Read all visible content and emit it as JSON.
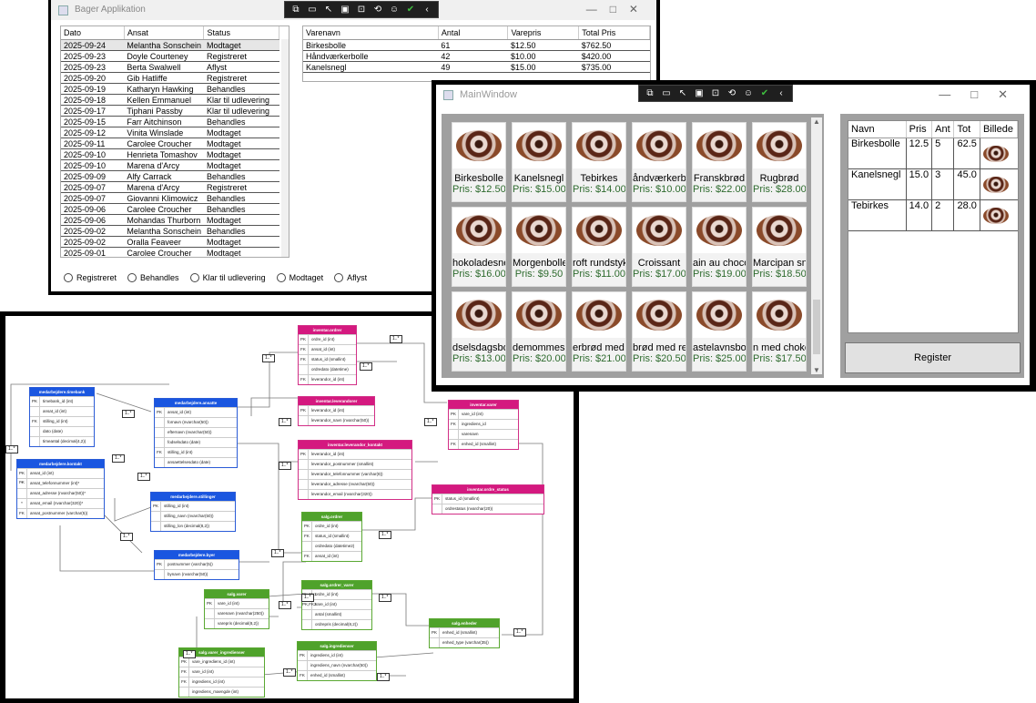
{
  "bager": {
    "title": "Bager Applikation",
    "orders_headers": [
      "Dato",
      "Ansat",
      "Status"
    ],
    "orders": [
      [
        "2025-09-24",
        "Melantha Sonschein",
        "Modtaget"
      ],
      [
        "2025-09-23",
        "Doyle Courteney",
        "Registreret"
      ],
      [
        "2025-09-23",
        "Berta Swalwell",
        "Aflyst"
      ],
      [
        "2025-09-20",
        "Gib Hatliffe",
        "Registreret"
      ],
      [
        "2025-09-19",
        "Katharyn Hawking",
        "Behandles"
      ],
      [
        "2025-09-18",
        "Kellen Emmanuel",
        "Klar til udlevering"
      ],
      [
        "2025-09-17",
        "Tiphani Passby",
        "Klar til udlevering"
      ],
      [
        "2025-09-15",
        "Farr Aitchinson",
        "Behandles"
      ],
      [
        "2025-09-12",
        "Vinita Winslade",
        "Modtaget"
      ],
      [
        "2025-09-11",
        "Carolee Croucher",
        "Modtaget"
      ],
      [
        "2025-09-10",
        "Henrieta Tomashov",
        "Modtaget"
      ],
      [
        "2025-09-10",
        "Marena d'Arcy",
        "Modtaget"
      ],
      [
        "2025-09-09",
        "Alfy Carrack",
        "Behandles"
      ],
      [
        "2025-09-07",
        "Marena d'Arcy",
        "Registreret"
      ],
      [
        "2025-09-07",
        "Giovanni Klimowicz",
        "Behandles"
      ],
      [
        "2025-09-06",
        "Carolee Croucher",
        "Behandles"
      ],
      [
        "2025-09-06",
        "Mohandas Thurborn",
        "Modtaget"
      ],
      [
        "2025-09-02",
        "Melantha Sonschein",
        "Behandles"
      ],
      [
        "2025-09-02",
        "Oralla Feaveer",
        "Modtaget"
      ],
      [
        "2025-09-01",
        "Carolee Croucher",
        "Modtaget"
      ]
    ],
    "items_headers": [
      "Varenavn",
      "Antal",
      "Varepris",
      "Total Pris"
    ],
    "items": [
      [
        "Birkesbolle",
        "61",
        "$12.50",
        "$762.50"
      ],
      [
        "Håndværkerbolle",
        "42",
        "$10.00",
        "$420.00"
      ],
      [
        "Kanelsnegl",
        "49",
        "$15.00",
        "$735.00"
      ]
    ],
    "filters": [
      "Registreret",
      "Behandles",
      "Klar til udlevering",
      "Modtaget",
      "Aflyst"
    ]
  },
  "main": {
    "title": "MainWindow",
    "products": [
      {
        "name": "Birkesbolle",
        "price": "Pris: $12.50"
      },
      {
        "name": "Kanelsnegl",
        "price": "Pris: $15.00"
      },
      {
        "name": "Tebirkes",
        "price": "Pris: $14.00"
      },
      {
        "name": "åndværkerbo",
        "price": "Pris: $10.00"
      },
      {
        "name": "Franskbrød",
        "price": "Pris: $22.00"
      },
      {
        "name": "Rugbrød",
        "price": "Pris: $28.00"
      },
      {
        "name": "hokoladesne",
        "price": "Pris: $16.00"
      },
      {
        "name": "Morgenbolle",
        "price": "Pris: $9.50"
      },
      {
        "name": "roft rundstyk",
        "price": "Pris: $11.00"
      },
      {
        "name": "Croissant",
        "price": "Pris: $17.00"
      },
      {
        "name": "ain au chocol",
        "price": "Pris: $19.00"
      },
      {
        "name": "Marcipan sneg",
        "price": "Pris: $18.50"
      },
      {
        "name": "dselsdagsbo",
        "price": "Pris: $13.00"
      },
      {
        "name": "demommesn",
        "price": "Pris: $20.00"
      },
      {
        "name": "erbrød med c",
        "price": "Pris: $21.00"
      },
      {
        "name": "brød med re",
        "price": "Pris: $20.50"
      },
      {
        "name": "astelavnsboll",
        "price": "Pris: $25.00"
      },
      {
        "name": "n med choko",
        "price": "Pris: $17.50"
      }
    ],
    "cart_headers": [
      "Navn",
      "Pris",
      "Ant",
      "Tot",
      "Billede"
    ],
    "cart": [
      [
        "Birkesbolle",
        "12.5",
        "5",
        "62.5"
      ],
      [
        "Kanelsnegl",
        "15.0",
        "3",
        "45.0"
      ],
      [
        "Tebirkes",
        "14.0",
        "2",
        "28.0"
      ]
    ],
    "register_label": "Register"
  },
  "erd": {
    "entities": [
      {
        "title": "medarbejdere.timebank",
        "color": "blue",
        "rows": [
          [
            "PK",
            "timebank_id (int)"
          ],
          [
            "",
            "ansat_id (int)"
          ],
          [
            "FK",
            "stilling_id (int)"
          ],
          [
            "",
            "dato (date)"
          ],
          [
            "",
            "timeantal (decimal(4,2))"
          ]
        ]
      },
      {
        "title": "medarbejdere.ansatte",
        "color": "blue",
        "rows": [
          [
            "PK",
            "ansat_id (int)"
          ],
          [
            "",
            "fornavn (nvarchar(50))"
          ],
          [
            "",
            "efternavn (nvarchar(50))"
          ],
          [
            "",
            "fodselsdato (date)"
          ],
          [
            "FK",
            "stilling_id (int)"
          ],
          [
            "",
            "ansaettelsesdato (date)"
          ]
        ]
      },
      {
        "title": "medarbejdere.kontakt",
        "color": "blue",
        "rows": [
          [
            "PK FK",
            "ansat_id (int)"
          ],
          [
            "*",
            "ansat_telefonnummer (int)*"
          ],
          [
            "",
            "ansat_adresse (nvarchar(50))*"
          ],
          [
            "*",
            "ansat_email (nvarchar(320))*"
          ],
          [
            "FK",
            "ansat_postnummer (varchar(5))"
          ]
        ]
      },
      {
        "title": "medarbejdere.stillinger",
        "color": "blue",
        "rows": [
          [
            "PK",
            "stilling_id (int)"
          ],
          [
            "",
            "stilling_navn (nvarchar(50))"
          ],
          [
            "",
            "stilling_lon (decimal(8,2))"
          ]
        ]
      },
      {
        "title": "medarbejdere.byer",
        "color": "blue",
        "rows": [
          [
            "PK",
            "postnummer (varchar(5))"
          ],
          [
            "",
            "bynavn (nvarchar(50))"
          ]
        ]
      },
      {
        "title": "inventar.ordrer",
        "color": "pink",
        "rows": [
          [
            "PK",
            "ordre_id (int)"
          ],
          [
            "FK",
            "ansat_id (int)"
          ],
          [
            "FK",
            "status_id (smallint)"
          ],
          [
            "",
            "ordredato (datetime)"
          ],
          [
            "FK",
            "leverandor_id (int)"
          ]
        ]
      },
      {
        "title": "inventar.leverandorer",
        "color": "pink",
        "rows": [
          [
            "PK",
            "leverandor_id (int)"
          ],
          [
            "",
            "leverandor_navn (nvarchar(50))"
          ]
        ]
      },
      {
        "title": "inventar.leverandor_kontakt",
        "color": "pink",
        "rows": [
          [
            "PK",
            "leverandor_id (int)"
          ],
          [
            "",
            "leverandor_postnummer (smallint)"
          ],
          [
            "",
            "leverandor_telefonnummer (varchar(8))"
          ],
          [
            "",
            "leverandor_adresse (nvarchar(50))"
          ],
          [
            "",
            "leverandor_email (nvarchar(320))"
          ]
        ]
      },
      {
        "title": "inventar.varer",
        "color": "pink",
        "rows": [
          [
            "PK",
            "vare_id (int)"
          ],
          [
            "FK",
            "ingrediens_id"
          ],
          [
            "",
            "varenavn"
          ],
          [
            "FK",
            "enhed_id (smallint)"
          ]
        ]
      },
      {
        "title": "inventar.ordre_status",
        "color": "pink",
        "rows": [
          [
            "PK",
            "status_id (smallint)"
          ],
          [
            "",
            "ordrestatus (nvarchar(20))"
          ]
        ]
      },
      {
        "title": "salg.ordrer",
        "color": "green",
        "rows": [
          [
            "PK",
            "ordre_id (int)"
          ],
          [
            "FK",
            "status_id (smallint)"
          ],
          [
            "",
            "ordredato (datetime2)"
          ],
          [
            "FK",
            "ansat_id (int)"
          ]
        ]
      },
      {
        "title": "salg.ordrer_varer",
        "color": "green",
        "rows": [
          [
            "PK,FK1",
            "ordre_id (int)"
          ],
          [
            "PK,FK2",
            "vare_id (int)"
          ],
          [
            "",
            "antal (smallint)"
          ],
          [
            "",
            "ordrepris (decimal(8,2))"
          ]
        ]
      },
      {
        "title": "salg.varer",
        "color": "green",
        "rows": [
          [
            "PK",
            "vare_id (int)"
          ],
          [
            "",
            "varenavn (nvarchar(250))"
          ],
          [
            "",
            "varepris (decimal(8,2))"
          ]
        ]
      },
      {
        "title": "salg.enheder",
        "color": "green",
        "rows": [
          [
            "PK",
            "enhed_id (smallint)"
          ],
          [
            "",
            "enhed_type (varchar(35))"
          ]
        ]
      },
      {
        "title": "salg.varer_ingredienser",
        "color": "green",
        "rows": [
          [
            "PK",
            "vare_ingrediens_id (int)"
          ],
          [
            "FK",
            "vare_id (int)"
          ],
          [
            "FK",
            "ingrediens_id (int)"
          ],
          [
            "",
            "ingrediens_maengde (int)"
          ]
        ]
      },
      {
        "title": "salg.ingredienser",
        "color": "green",
        "rows": [
          [
            "PK",
            "ingrediens_id (int)"
          ],
          [
            "",
            "ingrediens_navn (nvarchar(50))"
          ],
          [
            "FK",
            "enhed_id (smallint)"
          ]
        ]
      }
    ],
    "card_label": "1..*"
  },
  "colors": {
    "price_green": "#2e6b2e",
    "blue": "#1a56e0",
    "pink": "#d4197f",
    "green": "#4fa22b"
  }
}
